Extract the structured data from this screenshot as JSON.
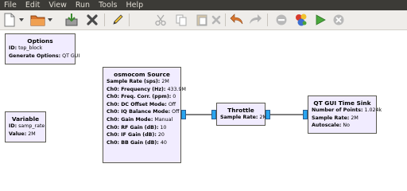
{
  "menubar": {
    "items": [
      "File",
      "Edit",
      "View",
      "Run",
      "Tools",
      "Help"
    ]
  },
  "toolbar": {
    "buttons": [
      "new-icon",
      "open-icon",
      "save-icon",
      "close-icon",
      "edit-pencil-icon",
      "cut-icon",
      "copy-icon",
      "paste-icon",
      "delete-icon",
      "undo-icon",
      "redo-icon",
      "disable-icon",
      "generate-icon",
      "execute-icon",
      "kill-icon"
    ]
  },
  "blocks": {
    "options": {
      "title": "Options",
      "rows": [
        {
          "key": "ID:",
          "value": " top_block"
        },
        {
          "key": "Generate Options:",
          "value": " QT GUI"
        }
      ]
    },
    "variable": {
      "title": "Variable",
      "rows": [
        {
          "key": "ID:",
          "value": " samp_rate"
        },
        {
          "key": "Value:",
          "value": " 2M"
        }
      ]
    },
    "osmocom": {
      "title": "osmocom Source",
      "rows": [
        {
          "key": "Sample Rate (sps):",
          "value": " 2M"
        },
        {
          "key": "Ch0: Frequency (Hz):",
          "value": " 433.9M"
        },
        {
          "key": "Ch0: Freq. Corr. (ppm):",
          "value": " 0"
        },
        {
          "key": "Ch0: DC Offset Mode:",
          "value": " Off"
        },
        {
          "key": "Ch0: IQ Balance Mode:",
          "value": " Off"
        },
        {
          "key": "Ch0: Gain Mode:",
          "value": " Manual"
        },
        {
          "key": "Ch0: RF Gain (dB):",
          "value": " 10"
        },
        {
          "key": "Ch0: IF Gain (dB):",
          "value": " 20"
        },
        {
          "key": "Ch0: BB Gain (dB):",
          "value": " 40"
        }
      ]
    },
    "throttle": {
      "title": "Throttle",
      "rows": [
        {
          "key": "Sample Rate:",
          "value": " 2M"
        }
      ]
    },
    "timesink": {
      "title": "QT GUI Time Sink",
      "rows": [
        {
          "key": "Number of Points:",
          "value": " 1.024k"
        },
        {
          "key": "Sample Rate:",
          "value": " 2M"
        },
        {
          "key": "Autoscale:",
          "value": " No"
        }
      ]
    }
  },
  "colors": {
    "block_fill": "#f1ecff",
    "port_fill": "#29a5ef",
    "menubar_bg": "#3c3b37",
    "toolbar_bg": "#efedea"
  }
}
